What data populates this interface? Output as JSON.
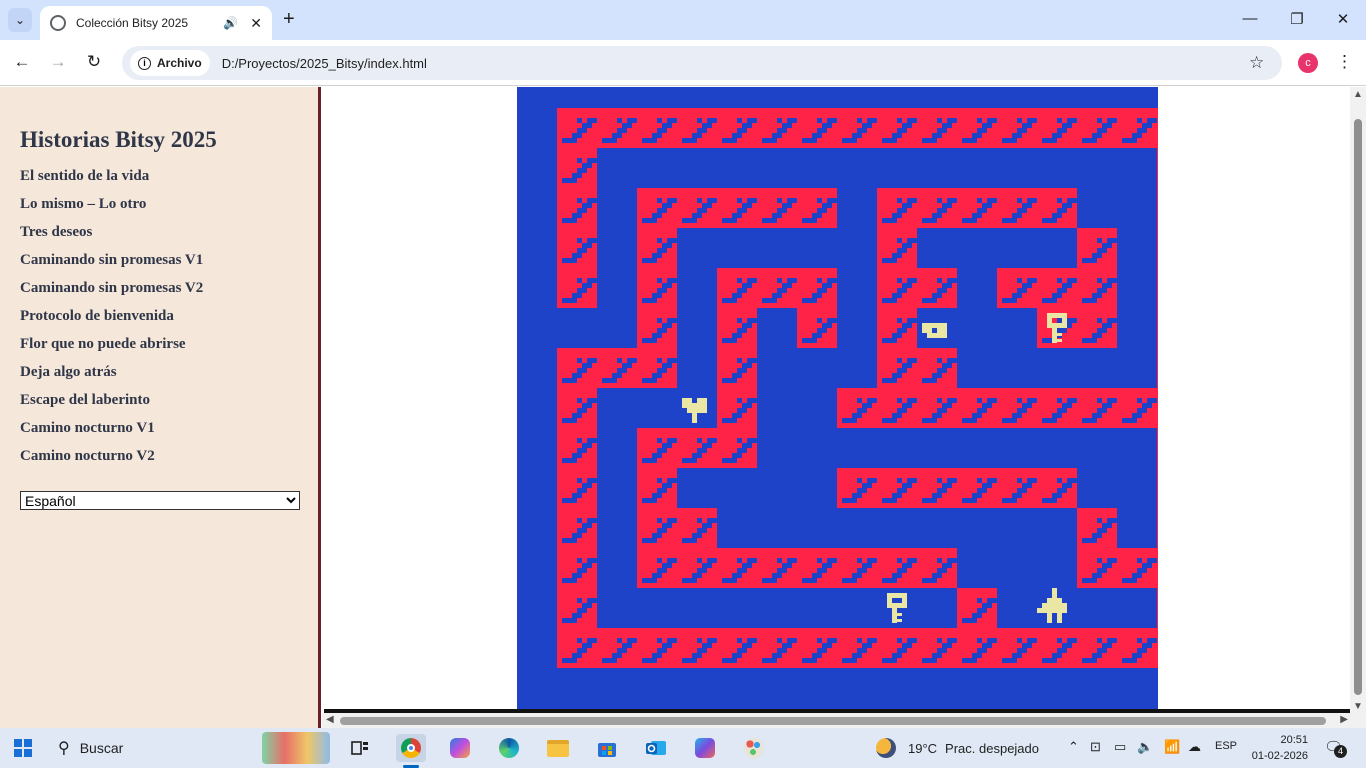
{
  "browser": {
    "tab_title": "Colección Bitsy 2025",
    "chip_label": "Archivo",
    "url": "D:/Proyectos/2025_Bitsy/index.html",
    "profile_initial": "c"
  },
  "sidebar": {
    "title": "Historias Bitsy 2025",
    "items": [
      {
        "label": "El sentido de la vida"
      },
      {
        "label": "Lo mismo – Lo otro"
      },
      {
        "label": "Tres deseos"
      },
      {
        "label": "Caminando sin promesas V1"
      },
      {
        "label": "Caminando sin promesas V2"
      },
      {
        "label": "Protocolo de bienvenida"
      },
      {
        "label": "Flor que no puede abrirse"
      },
      {
        "label": "Deja algo atrás"
      },
      {
        "label": "Escape del laberinto"
      },
      {
        "label": "Camino nocturno V1"
      },
      {
        "label": "Camino nocturno V2"
      }
    ],
    "language_selected": "Español"
  },
  "game": {
    "colors": {
      "background": "#1f43c8",
      "wall": "#ff2447",
      "wall_pattern": "#1f43c8",
      "sprite": "#eae7a5"
    },
    "grid_cols": 16,
    "maze": [
      "################",
      "#..............#",
      "#.#####.#####..#",
      "#.#.....#....#.#",
      "#.#.###.##.###.#",
      "..#.#.#.#...##.#",
      "###.#...##.....#",
      "#...#..#########",
      "#.###..........#",
      "#.#....######..#",
      "#.##.........#.#",
      "#.########...###",
      "#.........#....#",
      "################"
    ],
    "sprites": [
      {
        "type": "key",
        "row": 5,
        "col": 12
      },
      {
        "type": "ring",
        "row": 5,
        "col": 9
      },
      {
        "type": "flower",
        "row": 7,
        "col": 3
      },
      {
        "type": "key",
        "row": 12,
        "col": 8
      },
      {
        "type": "avatar",
        "row": 12,
        "col": 12
      }
    ]
  },
  "taskbar": {
    "search_label": "Buscar",
    "weather_temp": "19°C",
    "weather_condition": "Prac. despejado",
    "language": "ESP",
    "time": "20:51",
    "date": "01-02-2026",
    "notification_count": "4",
    "apps": [
      {
        "name": "task-view-icon"
      },
      {
        "name": "chrome-icon"
      },
      {
        "name": "copilot-icon"
      },
      {
        "name": "edge-icon"
      },
      {
        "name": "file-explorer-icon"
      },
      {
        "name": "microsoft-store-icon"
      },
      {
        "name": "outlook-icon"
      },
      {
        "name": "m365-icon"
      },
      {
        "name": "paint-icon"
      }
    ]
  }
}
